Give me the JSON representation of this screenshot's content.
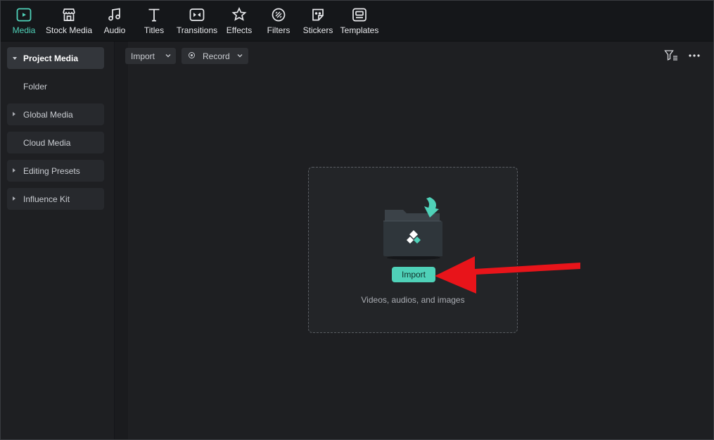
{
  "toolbar": {
    "tabs": [
      {
        "label": "Media",
        "icon": "media-icon",
        "active": true
      },
      {
        "label": "Stock Media",
        "icon": "stock-media-icon"
      },
      {
        "label": "Audio",
        "icon": "audio-icon"
      },
      {
        "label": "Titles",
        "icon": "titles-icon"
      },
      {
        "label": "Transitions",
        "icon": "transitions-icon"
      },
      {
        "label": "Effects",
        "icon": "effects-icon"
      },
      {
        "label": "Filters",
        "icon": "filters-icon"
      },
      {
        "label": "Stickers",
        "icon": "stickers-icon"
      },
      {
        "label": "Templates",
        "icon": "templates-icon"
      }
    ],
    "active_color": "#4fd1b8"
  },
  "sidebar": {
    "items": [
      {
        "label": "Project Media",
        "expanded": true
      },
      {
        "label": "Folder"
      },
      {
        "label": "Global Media"
      },
      {
        "label": "Cloud Media"
      },
      {
        "label": "Editing Presets"
      },
      {
        "label": "Influence Kit"
      }
    ]
  },
  "main": {
    "import_dropdown": "Import",
    "record_dropdown": "Record",
    "filter_icon": "filter-list-icon",
    "more_icon": "more-horizontal-icon",
    "dropzone": {
      "import_button": "Import",
      "hint": "Videos, audios, and images",
      "accent": "#4fd1b8"
    }
  },
  "annotation": {
    "arrow_color": "#e8141a"
  }
}
